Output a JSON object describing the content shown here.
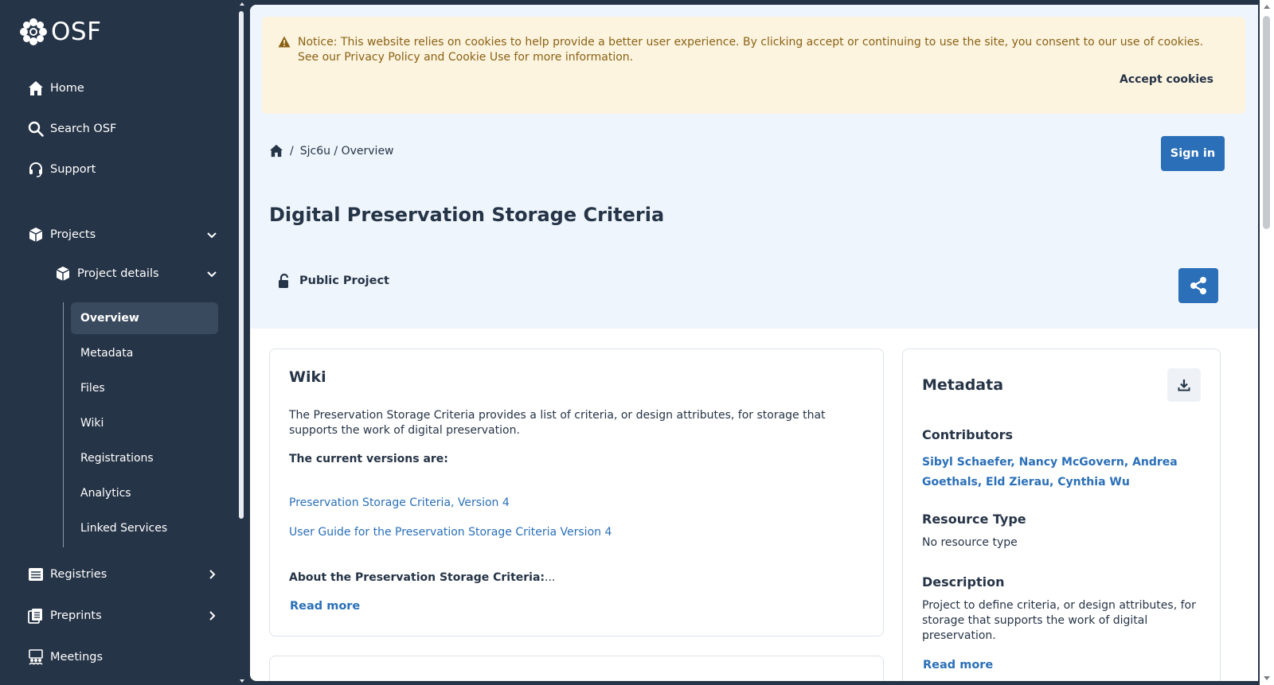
{
  "logo": {
    "text": "OSF"
  },
  "nav": {
    "home": "Home",
    "search": "Search OSF",
    "support": "Support",
    "projects": "Projects",
    "project_details": "Project details",
    "sub_items": [
      "Overview",
      "Metadata",
      "Files",
      "Wiki",
      "Registrations",
      "Analytics",
      "Linked Services"
    ],
    "registries": "Registries",
    "preprints": "Preprints",
    "meetings": "Meetings"
  },
  "cookie": {
    "text": "Notice: This website relies on cookies to help provide a better user experience. By clicking accept or continuing to use the site, you consent to our use of cookies. See our Privacy Policy and Cookie Use for more information.",
    "accept": "Accept cookies"
  },
  "breadcrumb": {
    "sep": "/",
    "path": "Sjc6u / Overview"
  },
  "signin": "Sign in",
  "page_title": "Digital Preservation Storage Criteria",
  "visibility": "Public Project",
  "wiki": {
    "title": "Wiki",
    "description": "The Preservation Storage Criteria provides a list of criteria, or design attributes, for storage that supports the work of digital preservation.",
    "versions_heading": "The current versions are:",
    "link1": "Preservation Storage Criteria, Version 4",
    "link2": "User Guide for the Preservation Storage Criteria Version 4",
    "about": "About the Preservation Storage Criteria:",
    "about_ellipsis": "...",
    "read_more": "Read more"
  },
  "metadata": {
    "title": "Metadata",
    "contributors_heading": "Contributors",
    "contributors": "Sibyl Schaefer, Nancy McGovern, Andrea Goethals, Eld Zierau, Cynthia Wu",
    "resource_type_heading": "Resource Type",
    "resource_type": "No resource type",
    "description_heading": "Description",
    "description": "Project to define criteria, or design attributes, for storage that supports the work of digital preservation.",
    "description_ellipsis": "...",
    "read_more": "Read more"
  },
  "colors": {
    "sidebar": "#263447",
    "accent": "#2a6fb8",
    "header_band": "#eef5fc",
    "cookie_bg": "#fdf4e0"
  }
}
